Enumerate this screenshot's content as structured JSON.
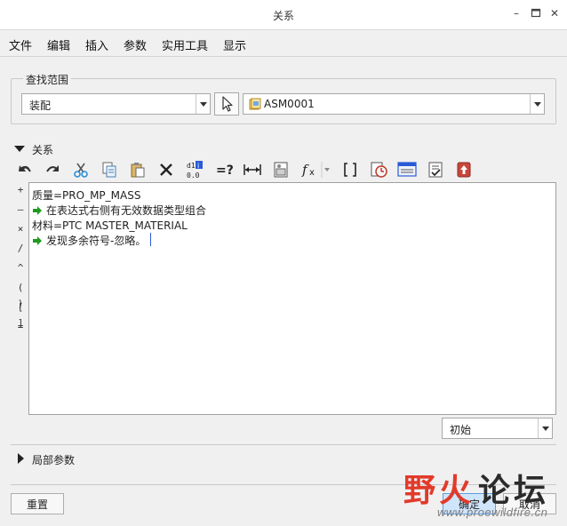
{
  "window": {
    "title": "关系",
    "minimize_glyph": "–",
    "restore_glyph": "▫",
    "close_glyph": "✕"
  },
  "menu": [
    "文件",
    "编辑",
    "插入",
    "参数",
    "实用工具",
    "显示"
  ],
  "scope": {
    "group_label": "查找范围",
    "type_value": "装配",
    "model_value": "ASM0001"
  },
  "relations": {
    "section_label": "关系",
    "toolbar": [
      "undo-icon",
      "redo-icon",
      "cut-icon",
      "copy-icon",
      "paste-icon",
      "delete-icon",
      "toggle-units-icon",
      "evaluate-icon",
      "measure-icon",
      "insert-param-icon",
      "function-icon",
      "brackets-icon",
      "verify-icon",
      "sort-icon",
      "options-icon",
      "export-icon"
    ],
    "operators": [
      "+",
      "–",
      "×",
      "/",
      "^",
      "( )",
      "[ ]",
      "="
    ],
    "lines": [
      {
        "text": "质量=PRO_MP_MASS",
        "type": "code"
      },
      {
        "text": "在表达式右侧有无效数据类型组合",
        "type": "message"
      },
      {
        "text": "材料=PTC MASTER_MATERIAL",
        "type": "code"
      },
      {
        "text": "发现多余符号-忽略。",
        "type": "message"
      }
    ],
    "sort_value": "初始"
  },
  "local_params": {
    "section_label": "局部参数"
  },
  "buttons": {
    "reset": "重置",
    "ok": "确定",
    "cancel": "取消"
  },
  "watermark": {
    "chars": [
      "野",
      "火",
      "论",
      "坛"
    ],
    "url": "www.proewildfire.cn"
  },
  "colors": {
    "accent": "#2a5bd7",
    "message_arrow": "#1f9a1f",
    "watermark_red": "#e23a2a"
  }
}
